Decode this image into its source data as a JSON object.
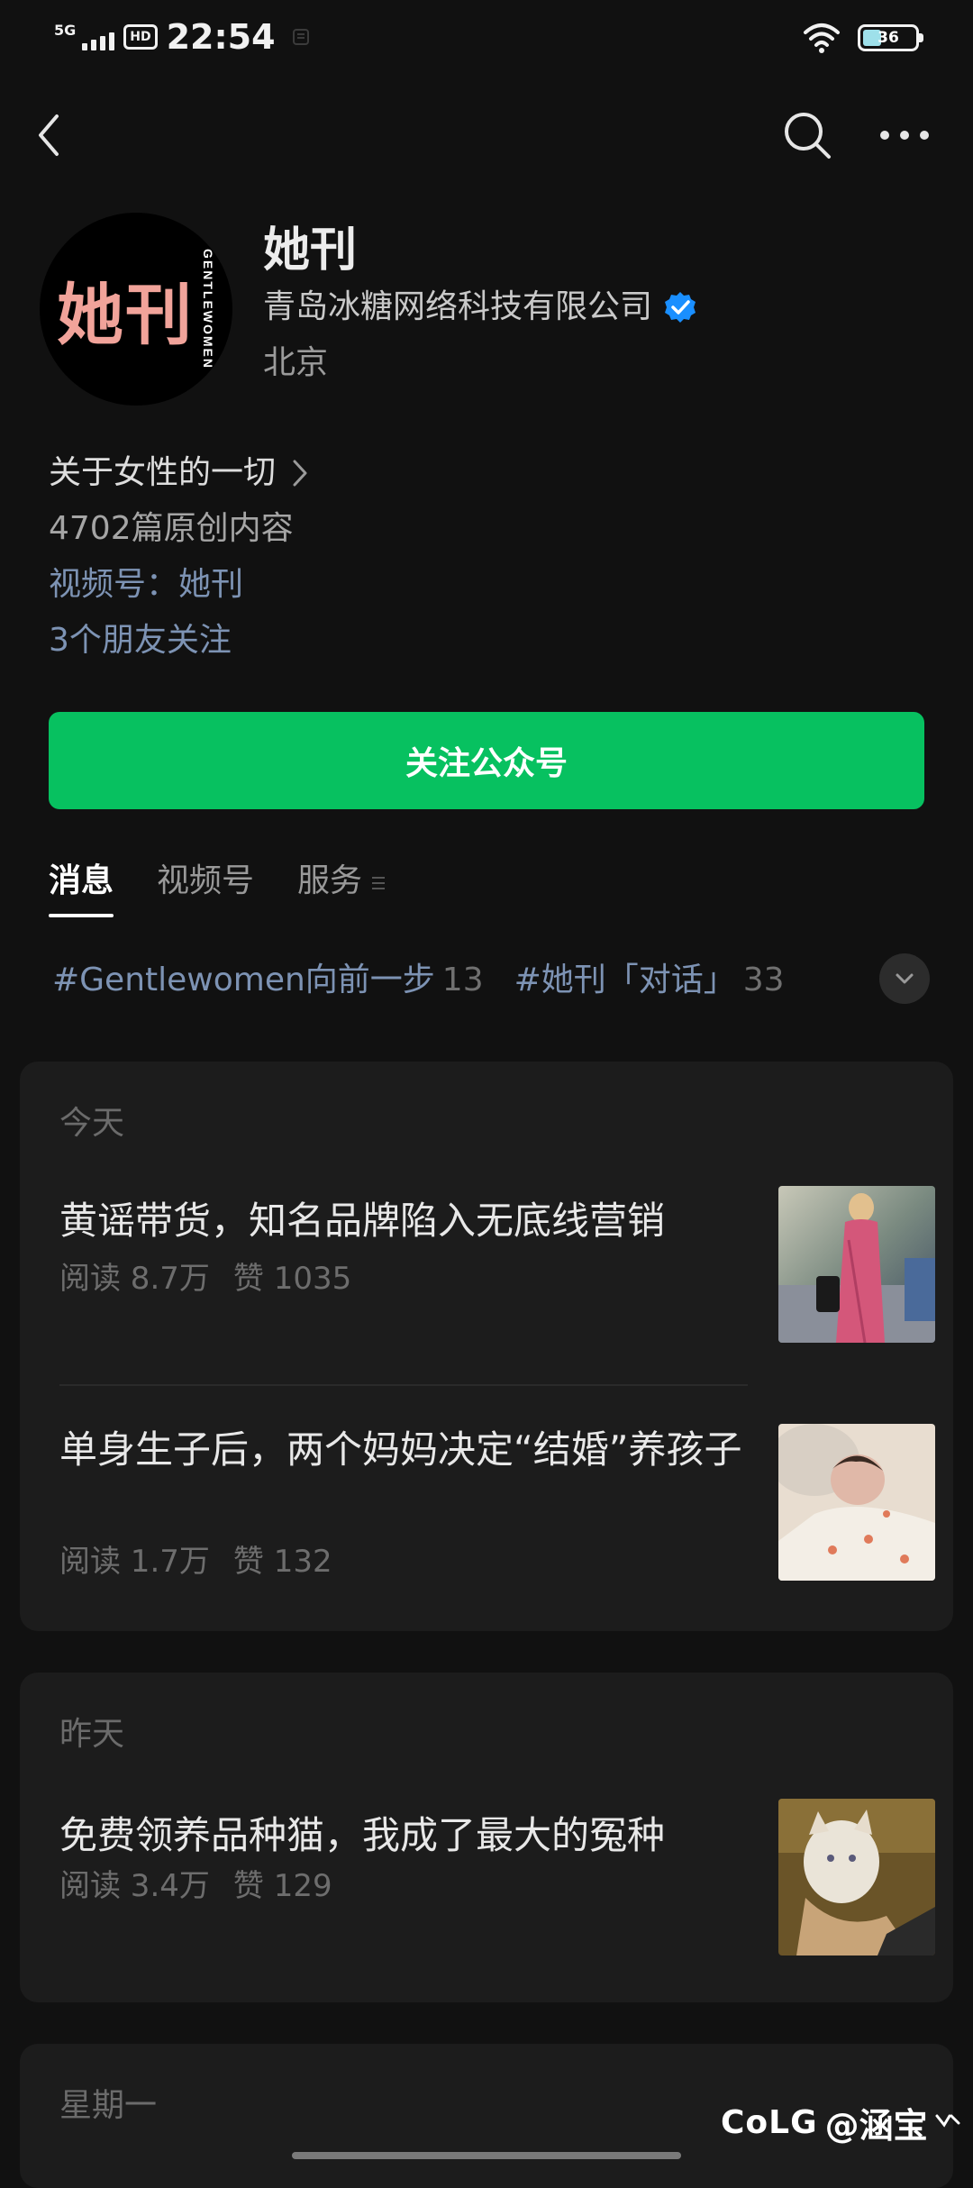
{
  "status_bar": {
    "network": "5G",
    "hd": "HD",
    "time": "22:54",
    "battery": "36",
    "battery_level": 0.36
  },
  "nav": {
    "back_icon": "chevron-left-icon",
    "search_icon": "search-icon",
    "more_icon": "more-icon"
  },
  "profile": {
    "avatar_text": "她刊",
    "avatar_subtext": "GENTLEWOMEN",
    "name": "她刊",
    "company": "青岛冰糖网络科技有限公司",
    "location": "北京"
  },
  "info": {
    "tagline": "关于女性的一切",
    "original_count": "4702篇原创内容",
    "video_channel": "视频号：她刊",
    "friends_following": "3个朋友关注"
  },
  "follow_button": "关注公众号",
  "tabs": [
    {
      "label": "消息",
      "active": true
    },
    {
      "label": "视频号",
      "active": false
    },
    {
      "label": "服务",
      "active": false
    }
  ],
  "topics": [
    {
      "name": "#Gentlewomen向前一步",
      "count": "13"
    },
    {
      "name": "#她刊「对话」",
      "count": "33"
    }
  ],
  "groups": [
    {
      "date": "今天",
      "articles": [
        {
          "title": "黄谣带货，知名品牌陷入无底线营销",
          "reads": "阅读 8.7万",
          "likes": "赞 1035"
        },
        {
          "title": "单身生子后，两个妈妈决定“结婚”养孩子",
          "reads": "阅读 1.7万",
          "likes": "赞 132"
        }
      ]
    },
    {
      "date": "昨天",
      "articles": [
        {
          "title": "免费领养品种猫，我成了最大的冤种",
          "reads": "阅读 3.4万",
          "likes": "赞 129"
        }
      ]
    },
    {
      "date": "星期一",
      "articles": []
    }
  ],
  "watermark": {
    "logo": "CoLG",
    "handle": "@涵宝"
  },
  "colors": {
    "background": "#111111",
    "card": "#1c1c1c",
    "accent_green": "#07c160",
    "link_blue": "#7d93b4",
    "verify_blue": "#1a8fff"
  }
}
